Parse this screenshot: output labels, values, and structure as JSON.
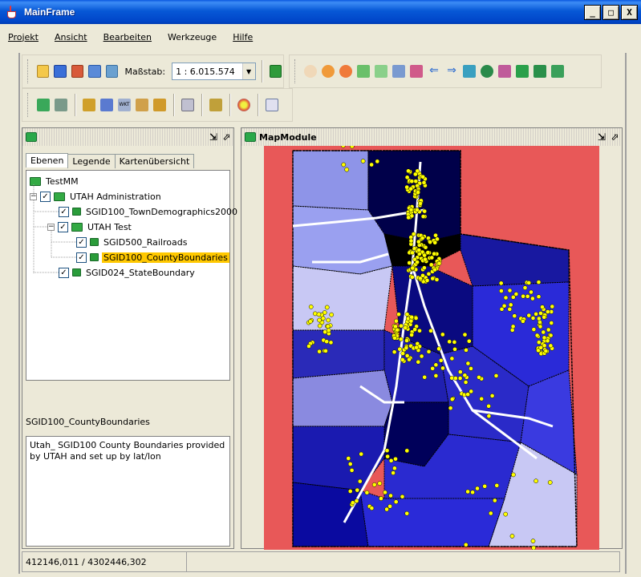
{
  "window": {
    "title": "MainFrame",
    "minimize": "_",
    "maximize": "□",
    "close": "X"
  },
  "menu": {
    "items": [
      {
        "label": "Projekt",
        "u": true
      },
      {
        "label": "Ansicht",
        "u": true
      },
      {
        "label": "Bearbeiten",
        "u": true
      },
      {
        "label": "Werkzeuge",
        "u": false
      },
      {
        "label": "Hilfe",
        "u": true
      }
    ]
  },
  "toolbar": {
    "scale_label": "Maßstab:",
    "scale_value": "1 : 6.015.574",
    "icons_row1a": [
      "open-folder-icon",
      "save-icon",
      "export-icon",
      "print-preview-icon",
      "settings-icon"
    ],
    "icons_row1b": [
      "pan-hand-icon",
      "zoom-in-icon",
      "zoom-out-icon",
      "zoom-extent-icon",
      "zoom-full-icon",
      "zoom-window-icon",
      "info-pick-icon",
      "back-arrow-icon",
      "forward-arrow-icon",
      "select-arrow-icon",
      "feature-info-icon",
      "search-icon",
      "layer-add-icon",
      "layer-remove-icon",
      "layer-up-icon"
    ],
    "icons_row2": [
      "layer-green-icon",
      "layer-gray-icon",
      "wms-icon",
      "shape-icon",
      "wkt-icon",
      "image-icon",
      "clipboard-icon",
      "printer-icon",
      "edit-icon",
      "color-palette-icon",
      "table-icon"
    ]
  },
  "colors": {
    "accent": "#0a58e0",
    "selection": "#ffc800",
    "map_bg": "#e85858",
    "county_dark": "#000033",
    "dots": "#ffff00"
  },
  "left_panel": {
    "tabs": [
      "Ebenen",
      "Legende",
      "Kartenübersicht"
    ],
    "tree": [
      {
        "label": "TestMM",
        "level": 0,
        "expander": "",
        "checkbox": false,
        "selected": false
      },
      {
        "label": "UTAH Administration",
        "level": 1,
        "expander": "−",
        "checkbox": true,
        "selected": false
      },
      {
        "label": "SGID100_TownDemographics2000",
        "level": 2,
        "expander": "",
        "checkbox": true,
        "selected": false
      },
      {
        "label": "UTAH Test",
        "level": 2,
        "expander": "−",
        "checkbox": true,
        "selected": false
      },
      {
        "label": "SGID500_Railroads",
        "level": 3,
        "expander": "",
        "checkbox": true,
        "selected": false
      },
      {
        "label": "SGID100_CountyBoundaries",
        "level": 3,
        "expander": "",
        "checkbox": true,
        "selected": true
      },
      {
        "label": "SGID024_StateBoundary",
        "level": 2,
        "expander": "",
        "checkbox": true,
        "selected": false
      }
    ],
    "layer_title": "SGID100_CountyBoundaries",
    "description": "Utah_ SGID100 County Boundaries provided by UTAH and set up by lat/lon"
  },
  "map_panel": {
    "title": "MapModule"
  },
  "status": {
    "coords": "412146,011 / 4302446,302",
    "extra": ""
  }
}
